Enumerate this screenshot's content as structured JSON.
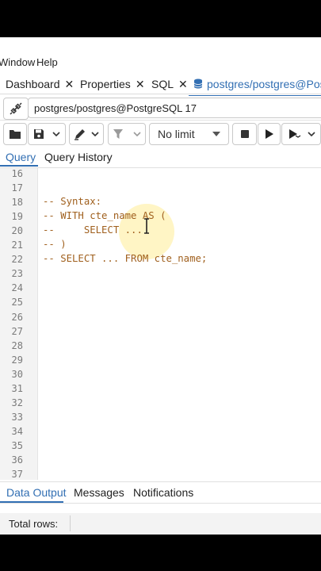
{
  "menubar": {
    "items": [
      "Window",
      "Help"
    ]
  },
  "tabs": [
    {
      "label": "Dashboard"
    },
    {
      "label": "Properties"
    },
    {
      "label": "SQL"
    },
    {
      "label": "postgres/postgres@Pos"
    }
  ],
  "tab_close": "✕",
  "connection": {
    "value": "postgres/postgres@PostgreSQL 17"
  },
  "toolbar": {
    "limit_label": "No limit"
  },
  "query_tabs": [
    {
      "label": "Query"
    },
    {
      "label": "Query History"
    }
  ],
  "editor": {
    "lines": [
      {
        "num": "16",
        "text": ""
      },
      {
        "num": "17",
        "text": ""
      },
      {
        "num": "18",
        "text": "-- Syntax:"
      },
      {
        "num": "19",
        "text": "-- WITH cte_name AS ("
      },
      {
        "num": "20",
        "text": "--     SELECT ..."
      },
      {
        "num": "21",
        "text": "-- )"
      },
      {
        "num": "22",
        "text": "-- SELECT ... FROM cte_name;"
      },
      {
        "num": "23",
        "text": ""
      },
      {
        "num": "24",
        "text": ""
      },
      {
        "num": "25",
        "text": ""
      },
      {
        "num": "26",
        "text": ""
      },
      {
        "num": "27",
        "text": ""
      },
      {
        "num": "28",
        "text": ""
      },
      {
        "num": "29",
        "text": ""
      },
      {
        "num": "30",
        "text": ""
      },
      {
        "num": "31",
        "text": ""
      },
      {
        "num": "32",
        "text": ""
      },
      {
        "num": "33",
        "text": ""
      },
      {
        "num": "34",
        "text": ""
      },
      {
        "num": "35",
        "text": ""
      },
      {
        "num": "36",
        "text": ""
      },
      {
        "num": "37",
        "text": ""
      }
    ]
  },
  "bottom_tabs": [
    {
      "label": "Data Output"
    },
    {
      "label": "Messages"
    },
    {
      "label": "Notifications"
    }
  ],
  "status": {
    "total_rows_label": "Total rows:"
  },
  "colors": {
    "accent": "#326fb3",
    "comment": "#a0601e"
  }
}
